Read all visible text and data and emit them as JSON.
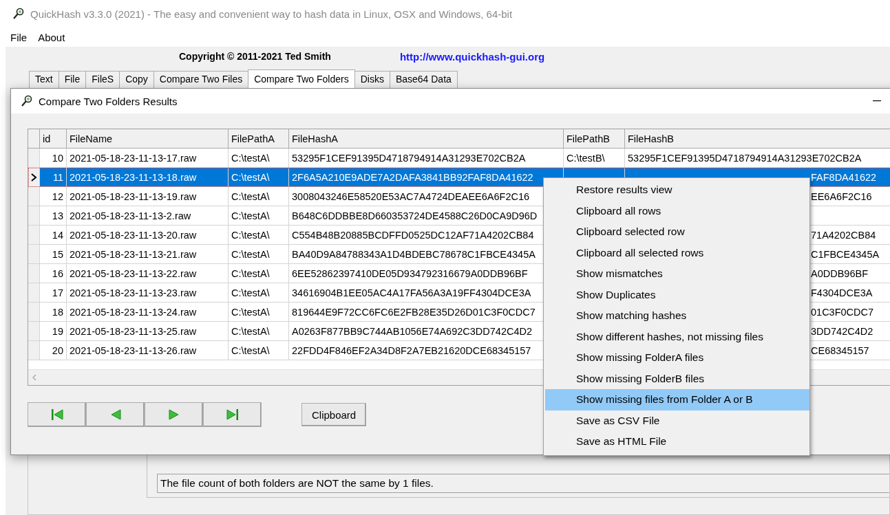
{
  "window": {
    "title": "QuickHash v3.3.0 (2021) - The easy and convenient way to hash data in Linux, OSX and Windows, 64-bit"
  },
  "menu_bar": [
    "File",
    "About"
  ],
  "copyright": "Copyright © 2011-2021  Ted Smith",
  "website_link": "http://www.quickhash-gui.org",
  "tabs": [
    {
      "label": "Text",
      "selected": false
    },
    {
      "label": "File",
      "selected": false
    },
    {
      "label": "FileS",
      "selected": false
    },
    {
      "label": "Copy",
      "selected": false
    },
    {
      "label": "Compare Two Files",
      "selected": false
    },
    {
      "label": "Compare Two Folders",
      "selected": true
    },
    {
      "label": "Disks",
      "selected": false
    },
    {
      "label": "Base64 Data",
      "selected": false
    }
  ],
  "status": {
    "value": "The file count of both folders are NOT the same by 1 files."
  },
  "dialog": {
    "title": "Compare Two Folders Results",
    "table": {
      "columns": [
        "id",
        "FileName",
        "FilePathA",
        "FileHashA",
        "FilePathB",
        "FileHashB"
      ],
      "rows": [
        {
          "id": "10",
          "file_name": "2021-05-18-23-11-13-17.raw",
          "path_a": "C:\\testA\\",
          "hash_a": "53295F1CEF91395D4718794914A31293E702CB2A",
          "path_b": "C:\\testB\\",
          "hash_b": "53295F1CEF91395D4718794914A31293E702CB2A",
          "hash_b_covered": false,
          "selected": false
        },
        {
          "id": "11",
          "file_name": "2021-05-18-23-11-13-18.raw",
          "path_a": "C:\\testA\\",
          "hash_a": "2F6A5A210E9ADE7A2DAFA3841BB92FAF8DA41622",
          "hash_b": "FAF8DA41622",
          "hash_b_covered": true,
          "selected": true
        },
        {
          "id": "12",
          "file_name": "2021-05-18-23-11-13-19.raw",
          "path_a": "C:\\testA\\",
          "hash_a": "3008043246E58520E53AC7A4724DEAEE6A6F2C16",
          "hash_b": "EE6A6F2C16",
          "hash_b_covered": true,
          "selected": false
        },
        {
          "id": "13",
          "file_name": "2021-05-18-23-11-13-2.raw",
          "path_a": "C:\\testA\\",
          "hash_a": "B648C6DDBBE8D660353724DE4588C26D0CA9D96D",
          "selected": false
        },
        {
          "id": "14",
          "file_name": "2021-05-18-23-11-13-20.raw",
          "path_a": "C:\\testA\\",
          "hash_a": "C554B48B20885BCDFFD0525DC12AF71A4202CB84",
          "hash_b": "71A4202CB84",
          "hash_b_covered": true,
          "selected": false
        },
        {
          "id": "15",
          "file_name": "2021-05-18-23-11-13-21.raw",
          "path_a": "C:\\testA\\",
          "hash_a": "BA40D9A84788343A1D4BDEBC78678C1FBCE4345A",
          "hash_b": "C1FBCE4345A",
          "hash_b_covered": true,
          "selected": false
        },
        {
          "id": "16",
          "file_name": "2021-05-18-23-11-13-22.raw",
          "path_a": "C:\\testA\\",
          "hash_a": "6EE52862397410DE05D934792316679A0DDB96BF",
          "hash_b": "A0DDB96BF",
          "hash_b_covered": true,
          "selected": false
        },
        {
          "id": "17",
          "file_name": "2021-05-18-23-11-13-23.raw",
          "path_a": "C:\\testA\\",
          "hash_a": "34616904B1EE05AC4A17FA56A3A19FF4304DCE3A",
          "hash_b": "F4304DCE3A",
          "hash_b_covered": true,
          "selected": false
        },
        {
          "id": "18",
          "file_name": "2021-05-18-23-11-13-24.raw",
          "path_a": "C:\\testA\\",
          "hash_a": "819644E9F72CC6FC6E2FB28E35D26D01C3F0CDC7",
          "hash_b": "01C3F0CDC7",
          "hash_b_covered": true,
          "selected": false
        },
        {
          "id": "19",
          "file_name": "2021-05-18-23-11-13-25.raw",
          "path_a": "C:\\testA\\",
          "hash_a": "A0263F877BB9C744AB1056E74A692C3DD742C4D2",
          "hash_b": "3DD742C4D2",
          "hash_b_covered": true,
          "selected": false
        },
        {
          "id": "20",
          "file_name": "2021-05-18-23-11-13-26.raw",
          "path_a": "C:\\testA\\",
          "hash_a": "22FDD4F846EF2A34D8F2A7EB21620DCE68345157",
          "hash_b": "CE68345157",
          "hash_b_covered": true,
          "selected": false
        }
      ]
    },
    "nav_buttons": [
      {
        "kind": "first"
      },
      {
        "kind": "previous"
      },
      {
        "kind": "next"
      },
      {
        "kind": "last"
      }
    ],
    "clipboard_button": "Clipboard"
  },
  "context_menu": [
    {
      "label": "Restore results view",
      "selected": false
    },
    {
      "label": "Clipboard all rows",
      "selected": false
    },
    {
      "label": "Clipboard selected row",
      "selected": false
    },
    {
      "label": "Clipboard all selected rows",
      "selected": false
    },
    {
      "label": "Show mismatches",
      "selected": false
    },
    {
      "label": "Show Duplicates",
      "selected": false
    },
    {
      "label": "Show matching hashes",
      "selected": false
    },
    {
      "label": "Show different hashes, not missing files",
      "selected": false
    },
    {
      "label": "Show missing FolderA files",
      "selected": false
    },
    {
      "label": "Show missing FolderB files",
      "selected": false
    },
    {
      "label": "Show missing files from Folder A or B",
      "selected": true
    },
    {
      "label": "Save as CSV File",
      "selected": false
    },
    {
      "label": "Save as HTML File",
      "selected": false
    }
  ]
}
